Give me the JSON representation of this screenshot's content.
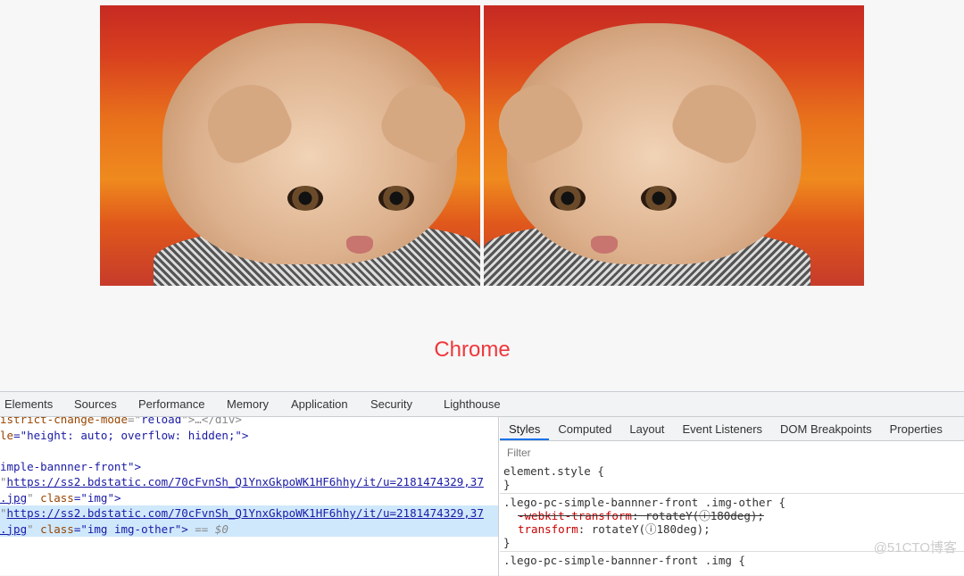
{
  "page": {
    "caption": "Chrome"
  },
  "images": [
    {
      "alt": "kitten"
    },
    {
      "alt": "kitten mirrored"
    }
  ],
  "devtools": {
    "tabs": [
      "Elements",
      "Sources",
      "Performance",
      "Memory",
      "Application",
      "Security",
      "Lighthouse"
    ],
    "active_tab": "Elements",
    "elements": {
      "l1a": "istrict-change-mode",
      "l1b": "=\"",
      "l1c": "reload",
      "l1d": "\">…</div>",
      "l2a": "le",
      "l2b": "=\"height: auto; overflow: hidden;\">",
      "l4": "imple-bannner-front\">",
      "l5": "https://ss2.bdstatic.com/70cFvnSh_Q1YnxGkpoWK1HF6hhy/it/u=2181474329,37",
      "l6a": ".jpg",
      "l6b": "class",
      "l6c": "=\"img\">",
      "l7": "https://ss2.bdstatic.com/70cFvnSh_Q1YnxGkpoWK1HF6hhy/it/u=2181474329,37",
      "l8a": ".jpg",
      "l8b": "class",
      "l8c": "=\"img img-other\">",
      "l8d": "== $0"
    },
    "styles_tabs": [
      "Styles",
      "Computed",
      "Layout",
      "Event Listeners",
      "DOM Breakpoints",
      "Properties"
    ],
    "filter_placeholder": "Filter",
    "rules": {
      "r1": "element.style {",
      "close": "}",
      "r2": ".lego-pc-simple-bannner-front .img-other {",
      "p1n": "-webkit-transform",
      "p1v": ": rotateY(ⓘ180deg);",
      "p2n": "transform",
      "p2v": ": rotateY(ⓘ180deg);",
      "r3": ".lego-pc-simple-bannner-front .img {"
    },
    "watermark": "@51CTO博客"
  }
}
